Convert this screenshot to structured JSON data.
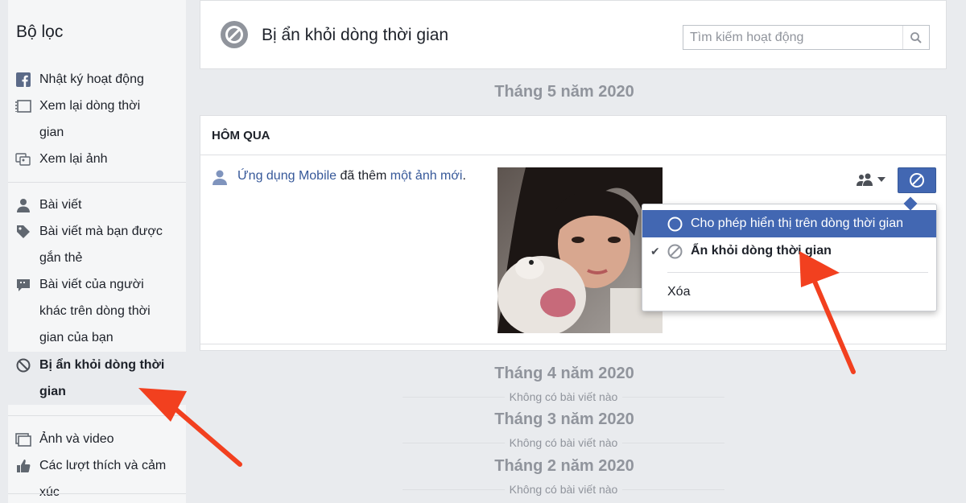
{
  "sidebar": {
    "title": "Bộ lọc",
    "items": [
      {
        "line1": "Nhật ký hoạt động",
        "icon": "facebook-icon"
      },
      {
        "line1": "Xem lại dòng thời",
        "line2": "gian",
        "icon": "timeline-review-icon"
      },
      {
        "line1": "Xem lại ảnh",
        "icon": "photo-review-icon"
      },
      {
        "line1": "Bài viết",
        "icon": "person-icon"
      },
      {
        "line1": "Bài viết mà bạn được",
        "line2": "gắn thẻ",
        "icon": "tag-icon"
      },
      {
        "line1": "Bài viết của người",
        "line2": "khác trên dòng thời",
        "line3": "gian của bạn",
        "icon": "comment-icon"
      },
      {
        "line1": "Bị ẩn khỏi dòng thời",
        "line2": "gian",
        "icon": "hidden-icon",
        "active": true
      },
      {
        "line1": "Ảnh và video",
        "icon": "photos-videos-icon"
      },
      {
        "line1": "Các lượt thích và cảm",
        "line2": "xúc",
        "icon": "like-icon"
      }
    ]
  },
  "header": {
    "title": "Bị ẩn khỏi dòng thời gian",
    "search_placeholder": "Tìm kiếm hoạt động"
  },
  "timeline": {
    "month_may": "Tháng 5 năm 2020",
    "section_label": "HÔM QUA",
    "story": {
      "actor": "Ứng dụng Mobile",
      "verb": "đã thêm",
      "object": "một ảnh mới",
      "period": "."
    },
    "empty_months": [
      {
        "month": "Tháng 4 năm 2020",
        "empty_text": "Không có bài viết nào"
      },
      {
        "month": "Tháng 3 năm 2020",
        "empty_text": "Không có bài viết nào"
      },
      {
        "month": "Tháng 2 năm 2020",
        "empty_text": "Không có bài viết nào"
      }
    ]
  },
  "dropdown": {
    "items": [
      {
        "label": "Cho phép hiển thị trên dòng thời gian",
        "highlighted": true
      },
      {
        "label": "Ẩn khỏi dòng thời gian",
        "checked": true
      },
      {
        "label": "Xóa"
      }
    ]
  },
  "colors": {
    "accent": "#4267b2",
    "link": "#365899",
    "annotation_arrow": "#f2401f"
  }
}
